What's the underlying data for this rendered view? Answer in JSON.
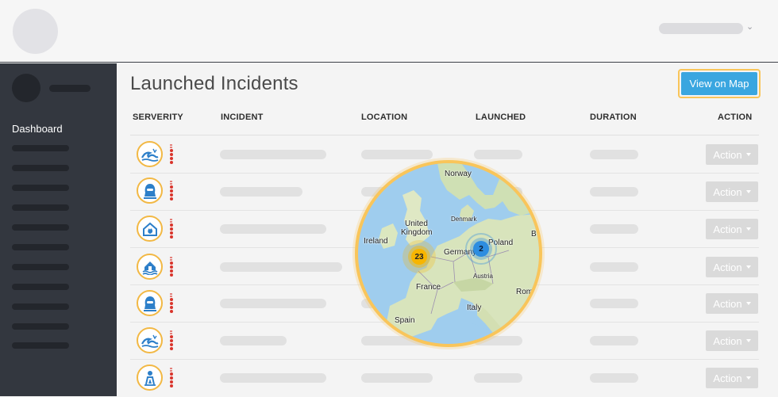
{
  "page": {
    "title": "Launched Incidents",
    "view_map_label": "View on Map"
  },
  "sidebar": {
    "active_item": "Dashboard"
  },
  "table": {
    "columns": [
      "SERVERITY",
      "INCIDENT",
      "LOCATION",
      "LAUNCHED",
      "DURATION",
      "ACTION"
    ],
    "action_label": "Action",
    "rows": [
      {
        "icon": "tsunami-icon",
        "severity_top": "3"
      },
      {
        "icon": "hooded-person-icon",
        "severity_top": "4"
      },
      {
        "icon": "house-fire-icon",
        "severity_top": "3"
      },
      {
        "icon": "house-flood-icon",
        "severity_top": "2"
      },
      {
        "icon": "hooded-person-icon",
        "severity_top": "3"
      },
      {
        "icon": "tsunami-icon",
        "severity_top": "3"
      },
      {
        "icon": "person-alert-icon",
        "severity_top": "2"
      }
    ]
  },
  "map": {
    "labels": {
      "norway": "Norway",
      "denmark": "Denmark",
      "united_kingdom_1": "United",
      "united_kingdom_2": "Kingdom",
      "ireland": "Ireland",
      "germany": "Germany",
      "poland": "Poland",
      "france": "France",
      "austria": "Austria",
      "italy": "Italy",
      "spain": "Spain",
      "rome": "Rom",
      "belarus_partial": "B"
    },
    "clusters": [
      {
        "label": "23",
        "color": "#f7b500"
      },
      {
        "label": "2",
        "color": "#2d8de0"
      }
    ]
  },
  "colors": {
    "accent_blue": "#3aa6e0",
    "highlight_yellow": "#f9c55a",
    "sidebar_bg": "#33373f",
    "severity_red": "#d9342b"
  }
}
